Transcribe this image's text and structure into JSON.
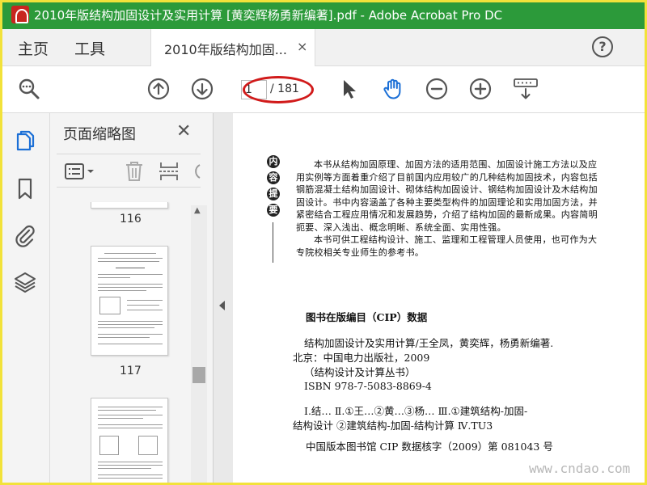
{
  "window": {
    "title": "2010年版结构加固设计及实用计算 [黄奕辉杨勇新编著].pdf - Adobe Acrobat Pro DC",
    "accent_color": "#2c9a3a"
  },
  "nav": {
    "home_label": "主页",
    "tools_label": "工具",
    "doc_tab_label": "2010年版结构加固...",
    "close_glyph": "×",
    "help_glyph": "?"
  },
  "toolbar": {
    "current_page": "1",
    "total_pages": "/ 181",
    "icons": [
      "zoom-search-icon",
      "page-up-icon",
      "page-down-icon",
      "select-cursor-icon",
      "hand-tool-icon",
      "zoom-out-icon",
      "zoom-in-icon",
      "keyboard-scroll-icon"
    ],
    "highlight_color": "#d11a1a"
  },
  "rail": {
    "icons": [
      "page-thumbnails-icon",
      "bookmark-icon",
      "attachment-icon",
      "layers-icon"
    ]
  },
  "thumbnails_panel": {
    "title": "页面缩略图",
    "close_glyph": "✕",
    "pages": [
      {
        "label": "116"
      },
      {
        "label": "117"
      }
    ]
  },
  "document": {
    "abstract_badge": [
      "内",
      "容",
      "提",
      "要"
    ],
    "abstract_paragraphs": [
      "本书从结构加固原理、加固方法的适用范围、加固设计施工方法以及应用实例等方面着重介绍了目前国内应用较广的几种结构加固技术，内容包括钢筋混凝土结构加固设计、砌体结构加固设计、钢结构加固设计及木结构加固设计。书中内容涵盖了各种主要类型构件的加固理论和实用加固方法，并紧密结合工程应用情况和发展趋势，介绍了结构加固的最新成果。内容简明扼要、深入浅出、概念明晰、系统全面、实用性强。",
      "本书可供工程结构设计、施工、监理和工程管理人员使用，也可作为大专院校相关专业师生的参考书。"
    ],
    "cip": {
      "title": "图书在版编目（CIP）数据",
      "lines": [
        "结构加固设计及实用计算/王全凤，黄奕辉，杨勇新编著.",
        "北京：中国电力出版社，2009",
        "（结构设计及计算丛书）",
        "ISBN 978-7-5083-8869-4",
        "Ⅰ.结…  Ⅱ.①王…②黄…③杨…  Ⅲ.①建筑结构-加固-",
        "结构设计 ②建筑结构-加固-结构计算  Ⅳ.TU3",
        "中国版本图书馆 CIP 数据核字（2009）第 081043 号"
      ]
    }
  },
  "watermark": "www.cndao.com"
}
